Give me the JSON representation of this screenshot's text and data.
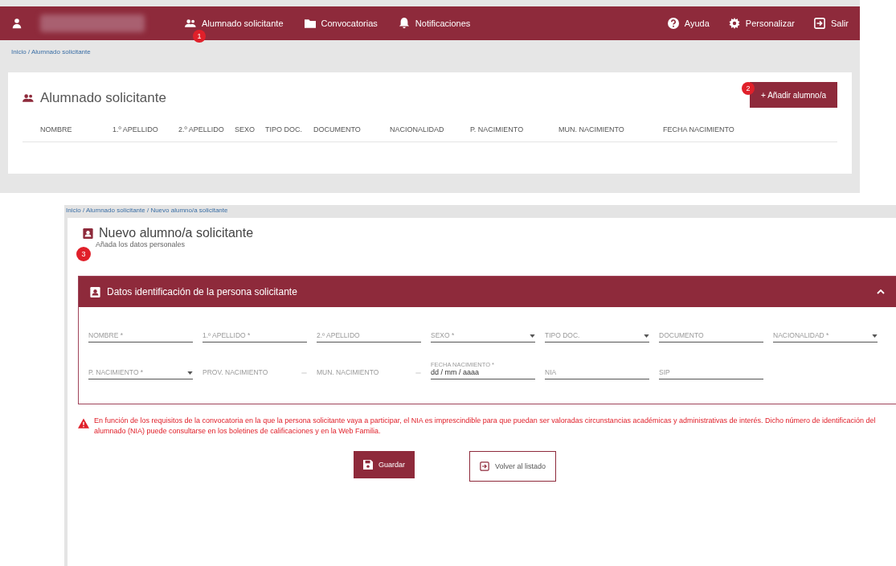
{
  "top_screen": {
    "header": {
      "nav": [
        {
          "label": "Alumnado solicitante",
          "badge": "1"
        },
        {
          "label": "Convocatorias"
        },
        {
          "label": "Notificaciones"
        }
      ],
      "actions": [
        {
          "label": "Ayuda"
        },
        {
          "label": "Personalizar"
        },
        {
          "label": "Salir"
        }
      ]
    },
    "breadcrumb": "Inicio / Alumnado solicitante",
    "card": {
      "title": "Alumnado solicitante",
      "add_button": {
        "label": "+ Añadir alumno/a",
        "badge": "2"
      },
      "columns": [
        "NOMBRE",
        "1.º APELLIDO",
        "2.º APELLIDO",
        "SEXO",
        "TIPO DOC.",
        "DOCUMENTO",
        "NACIONALIDAD",
        "P. NACIMIENTO",
        "MUN. NACIMIENTO",
        "FECHA NACIMIENTO"
      ]
    }
  },
  "form_screen": {
    "breadcrumb": "Inicio / Alumnado solicitante / Nuevo alumno/a solicitante",
    "title": "Nuevo alumno/a solicitante",
    "subtitle": "Añada los datos personales",
    "subtitle_badge": "3",
    "panel": {
      "title": "Datos identificación de la persona solicitante",
      "expanded": true,
      "rows": [
        [
          {
            "kind": "text",
            "label": "NOMBRE *",
            "disabled": false
          },
          {
            "kind": "text",
            "label": "1.º APELLIDO *",
            "disabled": false
          },
          {
            "kind": "text",
            "label": "2.º APELLIDO",
            "disabled": false
          },
          {
            "kind": "select",
            "label": "SEXO *",
            "disabled": false
          },
          {
            "kind": "select",
            "label": "TIPO DOC.",
            "disabled": false
          },
          {
            "kind": "text",
            "label": "DOCUMENTO",
            "disabled": false
          },
          {
            "kind": "select",
            "label": "NACIONALIDAD *",
            "disabled": false
          }
        ],
        [
          {
            "kind": "select",
            "label": "P. NACIMIENTO *",
            "disabled": false
          },
          {
            "kind": "select",
            "label": "PROV. NACIMIENTO",
            "disabled": true
          },
          {
            "kind": "select",
            "label": "MUN. NACIMIENTO",
            "disabled": true
          },
          {
            "kind": "date",
            "label": "FECHA NACIMIENTO *",
            "value": "dd / mm / aaaa",
            "disabled": false
          },
          {
            "kind": "text",
            "label": "NIA",
            "disabled": false
          },
          {
            "kind": "text",
            "label": "SIP",
            "disabled": false
          }
        ]
      ]
    },
    "warning": "En función de los requisitos de la convocatoria en la que la persona solicitante vaya a participar, el NIA es imprescindible para que puedan ser valoradas circunstancias académicas y administrativas de interés. Dicho número de identificación del alumnado (NIA) puede consultarse en los boletines de calificaciones y en la Web Familia.",
    "buttons": [
      {
        "kind": "primary",
        "label": "Guardar"
      },
      {
        "kind": "secondary",
        "label": "Volver al listado"
      }
    ]
  }
}
